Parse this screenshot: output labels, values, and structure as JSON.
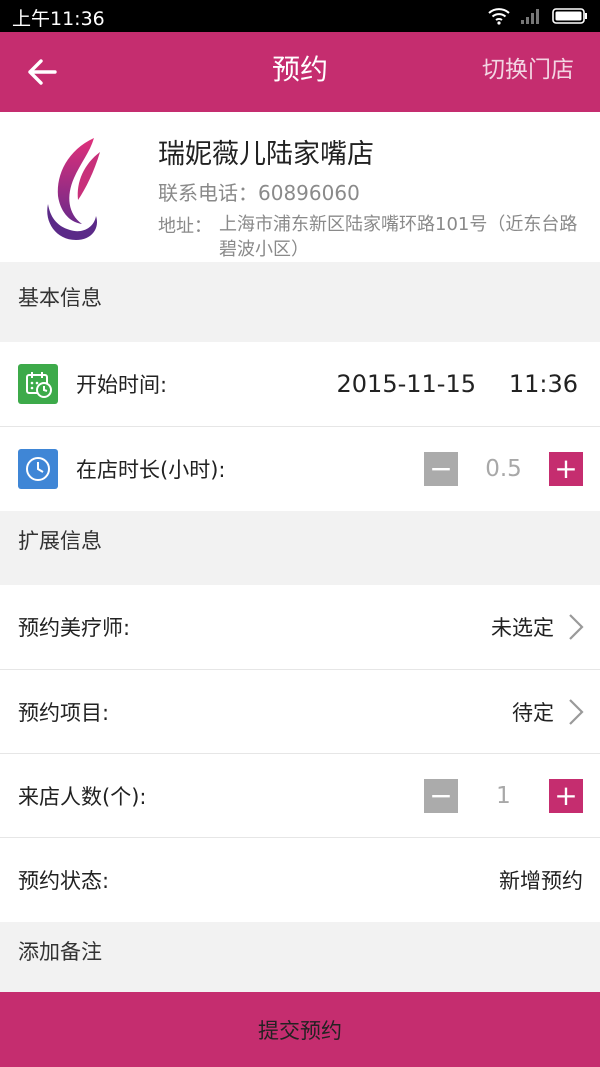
{
  "status": {
    "time": "上午11:36"
  },
  "header": {
    "title": "预约",
    "switch_label": "切换门店"
  },
  "store": {
    "name": "瑞妮薇儿陆家嘴店",
    "phone": "联系电话：60896060",
    "address_label": "地址：",
    "address": "上海市浦东新区陆家嘴环路101号（近东台路碧波小区）"
  },
  "basic": {
    "label": "基本信息",
    "start_label": "开始时间:",
    "start_date": "2015-11-15",
    "start_time": "11:36",
    "duration_label": "在店时长(小时):",
    "duration_value": "0.5"
  },
  "extended": {
    "label": "扩展信息",
    "therapist_label": "预约美疗师:",
    "therapist_value": "未选定",
    "project_label": "预约项目:",
    "project_value": "待定",
    "people_label": "来店人数(个):",
    "people_value": "1",
    "state_label": "预约状态:",
    "state_value": "新增预约"
  },
  "note": {
    "label": "添加备注"
  },
  "submit_label": "提交预约",
  "stepper_symbols": {
    "minus": "−",
    "plus": "+"
  },
  "colors": {
    "brand": "#c52d6f",
    "calendar_icon": "#3daa4a",
    "clock_icon": "#3f86d6",
    "minus_button": "#ababab"
  },
  "icons": [
    "back-arrow-icon",
    "wifi-icon",
    "signal-icon",
    "battery-icon",
    "calendar-icon",
    "clock-icon",
    "chevron-right-icon",
    "store-logo"
  ]
}
